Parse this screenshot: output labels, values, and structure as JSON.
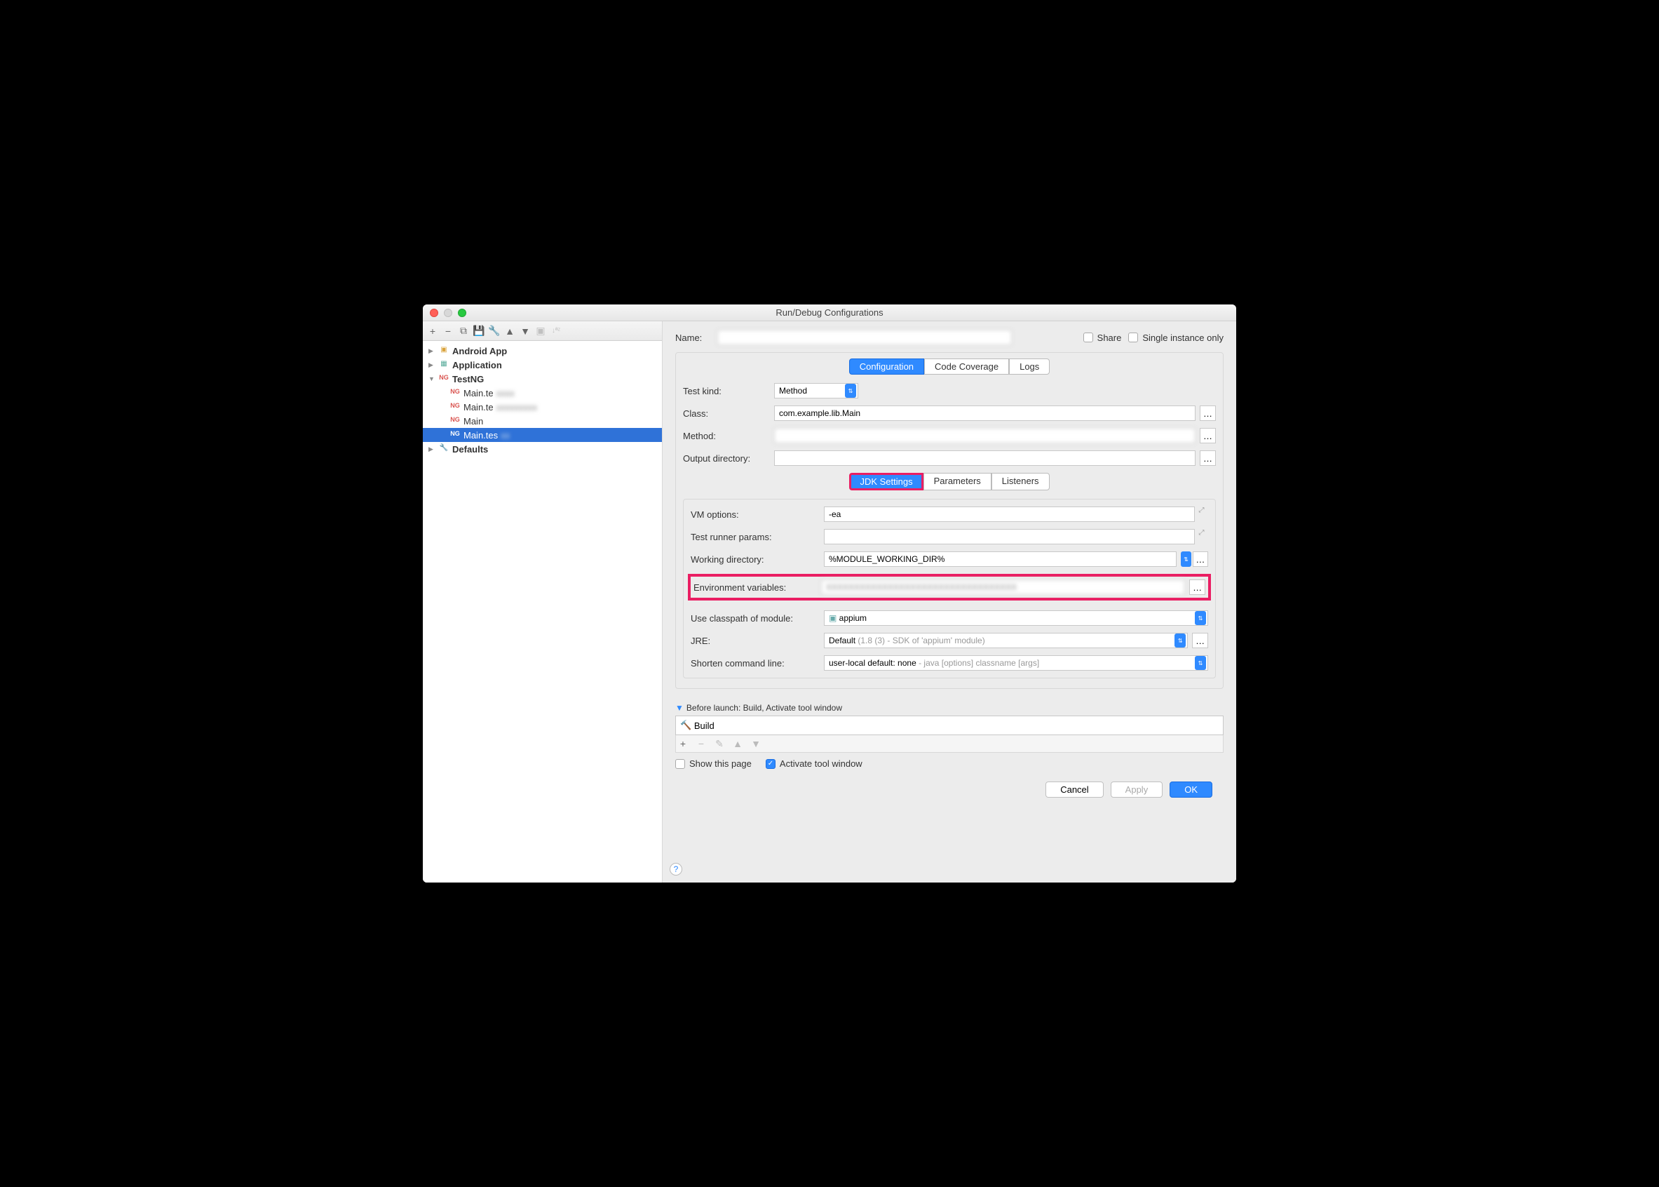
{
  "window": {
    "title": "Run/Debug Configurations"
  },
  "toolbar_icons": [
    "+",
    "−",
    "copy",
    "save",
    "wrench",
    "▲",
    "▼",
    "folder",
    "sort"
  ],
  "tree": {
    "android": "Android App",
    "application": "Application",
    "testng": "TestNG",
    "items": [
      "Main.te",
      "Main.te",
      "Main",
      "Main.tes"
    ],
    "defaults": "Defaults"
  },
  "name_label": "Name:",
  "share_label": "Share",
  "single_label": "Single instance only",
  "tabs": {
    "config": "Configuration",
    "coverage": "Code Coverage",
    "logs": "Logs"
  },
  "form": {
    "testkind_label": "Test kind:",
    "testkind_value": "Method",
    "class_label": "Class:",
    "class_value": "com.example.lib.Main",
    "method_label": "Method:",
    "output_label": "Output directory:"
  },
  "subtabs": {
    "jdk": "JDK Settings",
    "params": "Parameters",
    "listeners": "Listeners"
  },
  "jdk": {
    "vm_label": "VM options:",
    "vm_value": "-ea",
    "runner_label": "Test runner params:",
    "wd_label": "Working directory:",
    "wd_value": "%MODULE_WORKING_DIR%",
    "env_label": "Environment variables:",
    "classpath_label": "Use classpath of module:",
    "classpath_value": "appium",
    "jre_label": "JRE:",
    "jre_value": "Default",
    "jre_detail": "(1.8 (3) - SDK of 'appium' module)",
    "shorten_label": "Shorten command line:",
    "shorten_value": "user-local default: none",
    "shorten_detail": "- java [options] classname [args]"
  },
  "before": {
    "header": "Before launch: Build, Activate tool window",
    "build": "Build",
    "show": "Show this page",
    "activate": "Activate tool window"
  },
  "footer": {
    "cancel": "Cancel",
    "apply": "Apply",
    "ok": "OK"
  }
}
